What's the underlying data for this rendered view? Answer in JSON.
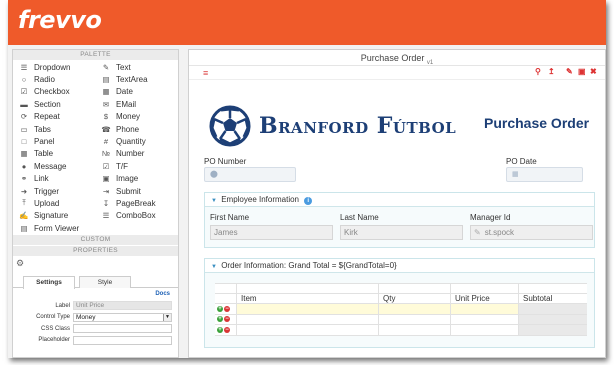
{
  "app": {
    "logo": "frevvo"
  },
  "palette": {
    "title": "PALETTE",
    "items": [
      {
        "label": "Dropdown",
        "icon": "☰"
      },
      {
        "label": "Text",
        "icon": "✎"
      },
      {
        "label": "Radio",
        "icon": "○"
      },
      {
        "label": "TextArea",
        "icon": "▤"
      },
      {
        "label": "Checkbox",
        "icon": "☑"
      },
      {
        "label": "Date",
        "icon": "▦"
      },
      {
        "label": "Section",
        "icon": "▬"
      },
      {
        "label": "EMail",
        "icon": "✉"
      },
      {
        "label": "Repeat",
        "icon": "⟳"
      },
      {
        "label": "Money",
        "icon": "$"
      },
      {
        "label": "Tabs",
        "icon": "▭"
      },
      {
        "label": "Phone",
        "icon": "☎"
      },
      {
        "label": "Panel",
        "icon": "□"
      },
      {
        "label": "Quantity",
        "icon": "#"
      },
      {
        "label": "Table",
        "icon": "▦"
      },
      {
        "label": "Number",
        "icon": "№"
      },
      {
        "label": "Message",
        "icon": "●"
      },
      {
        "label": "T/F",
        "icon": "☑"
      },
      {
        "label": "Link",
        "icon": "⚭"
      },
      {
        "label": "Image",
        "icon": "▣"
      },
      {
        "label": "Trigger",
        "icon": "➜"
      },
      {
        "label": "Submit",
        "icon": "⇥"
      },
      {
        "label": "Upload",
        "icon": "⤒"
      },
      {
        "label": "PageBreak",
        "icon": "↧"
      },
      {
        "label": "Signature",
        "icon": "✍"
      },
      {
        "label": "ComboBox",
        "icon": "☰"
      },
      {
        "label": "Form Viewer",
        "icon": "▤"
      }
    ],
    "custom_title": "CUSTOM",
    "properties_title": "PROPERTIES"
  },
  "properties": {
    "tabs": [
      "Settings",
      "Style"
    ],
    "docs_link": "Docs",
    "label_field": {
      "label": "Label",
      "value": "Unit Price"
    },
    "control_type": {
      "label": "Control Type",
      "value": "Money"
    },
    "css_class": {
      "label": "CSS Class",
      "value": ""
    },
    "placeholder": {
      "label": "Placeholder",
      "value": ""
    }
  },
  "form": {
    "title": "Purchase Order",
    "version": "v1",
    "company": "Branford Fútbol",
    "heading": "Purchase Order",
    "po_number_label": "PO Number",
    "po_date_label": "PO Date",
    "employee_section": {
      "title": "Employee Information",
      "first_name_label": "First Name",
      "last_name_label": "Last Name",
      "manager_label": "Manager Id",
      "first_name": "James",
      "last_name": "Kirk",
      "manager": "st.spock"
    },
    "order_section": {
      "title": "Order Information: Grand Total = ${GrandTotal=0}",
      "columns": [
        "Item",
        "Qty",
        "Unit Price",
        "Subtotal"
      ]
    }
  },
  "colors": {
    "accent": "#ef5a2a",
    "brand_blue": "#1d3f76"
  }
}
